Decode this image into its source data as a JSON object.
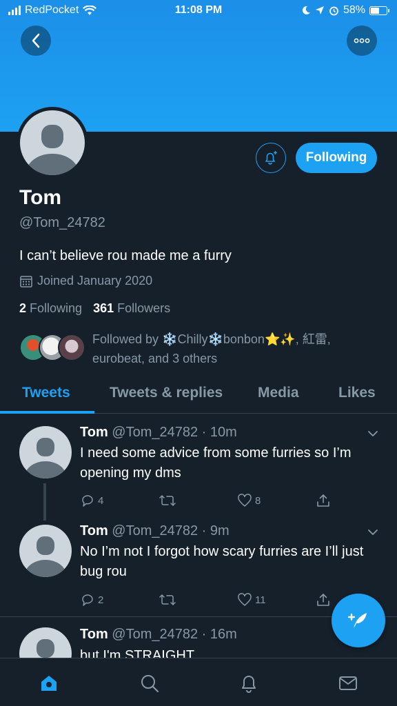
{
  "status_bar": {
    "carrier": "RedPocket",
    "time": "11:08 PM",
    "battery": "58%",
    "battery_level": 0.58
  },
  "header": {
    "back_icon": "chevron-left-icon",
    "more_icon": "more-horizontal-icon"
  },
  "profile": {
    "name": "Tom",
    "handle": "@Tom_24782",
    "bio": "I can’t believe rou made me a furry",
    "joined": "Joined January 2020",
    "following_count": "2",
    "following_label": "Following",
    "followers_count": "361",
    "followers_label": "Followers",
    "follow_button_label": "Following",
    "followed_by_line1": "Followed by ❄️Chilly❄️bonbon⭐✨, 紅雷,",
    "followed_by_line2": "eurobeat, and 3 others"
  },
  "tabs": [
    {
      "label": "Tweets",
      "active": true
    },
    {
      "label": "Tweets & replies",
      "active": false
    },
    {
      "label": "Media",
      "active": false
    },
    {
      "label": "Likes",
      "active": false
    }
  ],
  "tweets": [
    {
      "name": "Tom",
      "meta": "@Tom_24782 · 10m",
      "text": "I need some advice from some furries so I’m opening my dms",
      "replies": "4",
      "retweets": "",
      "likes": "8"
    },
    {
      "name": "Tom",
      "meta": "@Tom_24782 · 9m",
      "text": "No I’m not I forgot how scary furries are I’ll just bug rou",
      "replies": "2",
      "retweets": "",
      "likes": "11"
    },
    {
      "name": "Tom",
      "meta": "@Tom_24782 · 16m",
      "text": "but I'm STRAIGHT"
    }
  ],
  "colors": {
    "accent": "#1da1f2",
    "background": "#15202b",
    "secondary_text": "#8899a6",
    "border": "#38444d"
  }
}
